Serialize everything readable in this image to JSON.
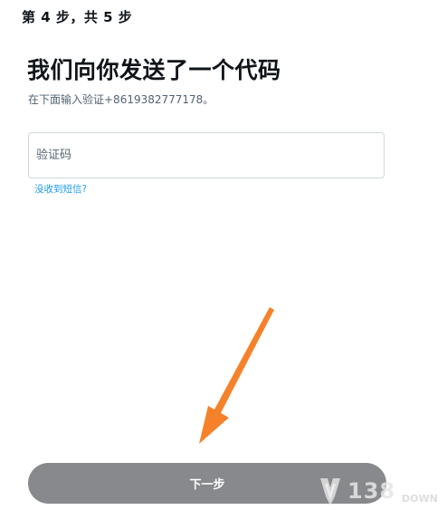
{
  "header": {
    "step_label": "第 4 步，共 5 步"
  },
  "main": {
    "title": "我们向你发送了一个代码",
    "subtitle": "在下面输入验证+8619382777178。",
    "code_input": {
      "placeholder": "验证码",
      "value": ""
    },
    "no_sms_link": "没收到短信?"
  },
  "footer": {
    "next_label": "下一步"
  },
  "watermark": {
    "text": "138",
    "suffix": "DOWN"
  },
  "colors": {
    "link": "#1d9bf0",
    "button_bg": "#87898c",
    "annotation_arrow": "#f5822a"
  }
}
